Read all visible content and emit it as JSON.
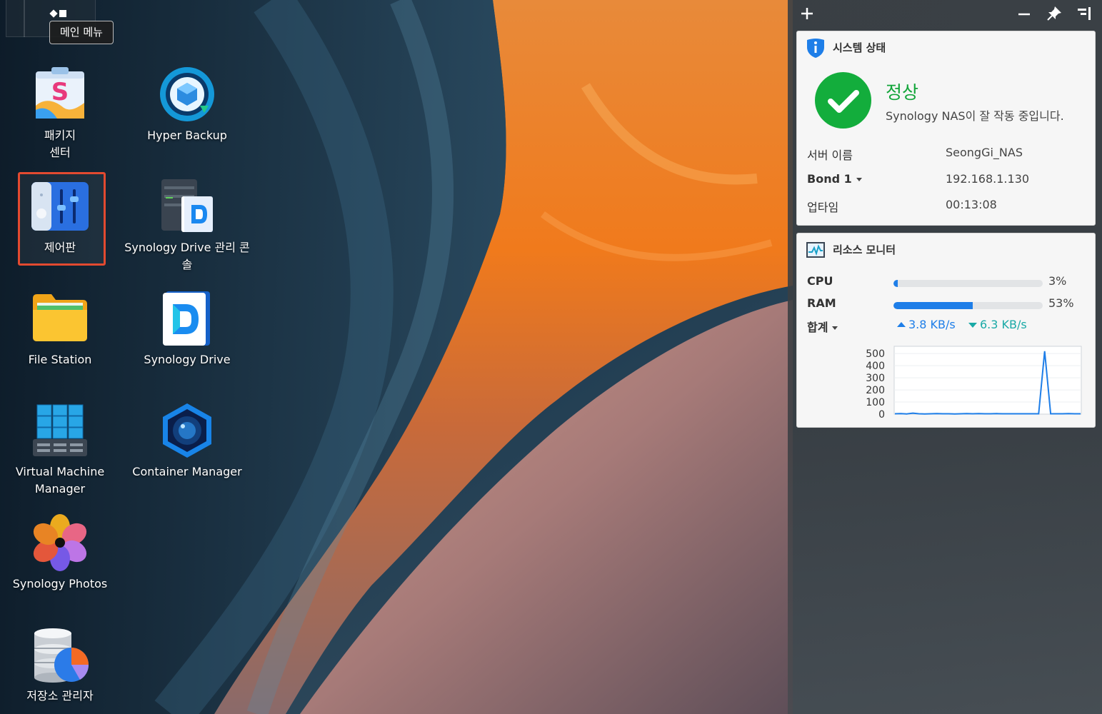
{
  "desktop": {
    "main_menu_tooltip": "메인 메뉴",
    "icons": [
      {
        "label": "패키지\n센터",
        "icon": "package-center-icon"
      },
      {
        "label": "Hyper Backup",
        "icon": "hyper-backup-icon"
      },
      {
        "label": "제어판",
        "icon": "control-panel-icon",
        "selected": true
      },
      {
        "label": "Synology Drive 관리 콘솔",
        "icon": "drive-admin-console-icon"
      },
      {
        "label": "File Station",
        "icon": "file-station-icon"
      },
      {
        "label": "Synology Drive",
        "icon": "synology-drive-icon"
      },
      {
        "label": "Virtual Machine Manager",
        "icon": "vm-manager-icon"
      },
      {
        "label": "Container Manager",
        "icon": "container-manager-icon"
      },
      {
        "label": "Synology Photos",
        "icon": "synology-photos-icon"
      },
      {
        "label": "저장소 관리자",
        "icon": "storage-manager-icon"
      }
    ]
  },
  "system_status": {
    "title": "시스템 상태",
    "headline": "정상",
    "description": "Synology NAS이 잘 작동 중입니다.",
    "rows": [
      {
        "key": "서버 이름",
        "value": "SeongGi_NAS"
      },
      {
        "key": "Bond 1",
        "value": "192.168.1.130"
      },
      {
        "key": "업타임",
        "value": "00:13:08"
      }
    ]
  },
  "resource_monitor": {
    "title": "리소스 모니터",
    "cpu_label": "CPU",
    "cpu_percent": 3,
    "cpu_text": "3%",
    "ram_label": "RAM",
    "ram_percent": 53,
    "ram_text": "53%",
    "net_label": "합계",
    "upload": "3.8 KB/s",
    "download": "6.3 KB/s"
  },
  "colors": {
    "accent_blue": "#1e7ee8",
    "ok_green": "#13ad3c",
    "selection_red": "#e34a30",
    "download_teal": "#19a9a6"
  },
  "chart_data": {
    "type": "line",
    "y_ticks": [
      500,
      400,
      300,
      200,
      100,
      0
    ],
    "ylim": [
      0,
      560
    ],
    "series": [
      {
        "values": [
          3,
          4,
          2,
          8,
          3,
          2,
          3,
          4,
          3,
          3,
          2,
          3,
          4,
          3,
          4,
          3,
          3,
          4,
          3,
          3,
          3,
          3,
          3,
          3,
          3,
          520,
          3,
          3,
          3,
          4,
          3,
          3
        ]
      }
    ],
    "grid": true
  }
}
